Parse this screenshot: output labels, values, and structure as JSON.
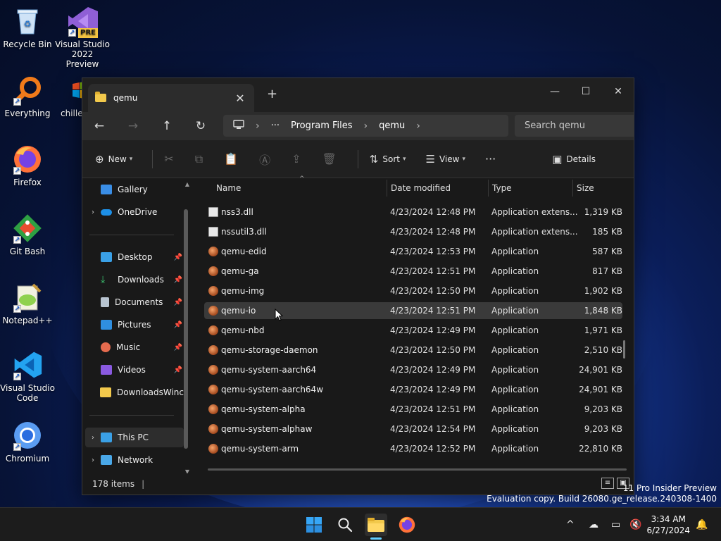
{
  "desktop": {
    "icons": [
      {
        "label": "Recycle Bin"
      },
      {
        "label": "Visual Studio 2022 Preview",
        "badge": "PRE"
      },
      {
        "label": "Everything"
      },
      {
        "label": "chille"
      },
      {
        "label": "Firefox"
      },
      {
        "label": "Git Bash"
      },
      {
        "label": "Notepad++"
      },
      {
        "label": "Visual Studio Code"
      },
      {
        "label": "Chromium"
      }
    ]
  },
  "window": {
    "tab_title": "qemu",
    "close_glyph": "✕",
    "new_tab_glyph": "+",
    "minimize_glyph": "—",
    "maximize_glyph": "☐",
    "close_window_glyph": "✕"
  },
  "nav": {
    "back": "←",
    "forward": "→",
    "up": "↑",
    "refresh": "↻",
    "breadcrumb": [
      "Program Files",
      "qemu"
    ],
    "ellipsis": "···",
    "search_placeholder": "Search qemu"
  },
  "toolbar": {
    "new_label": "New",
    "sort_label": "Sort",
    "view_label": "View",
    "more_glyph": "···",
    "details_label": "Details"
  },
  "sidebar": {
    "items": [
      {
        "label": "Gallery"
      },
      {
        "label": "OneDrive"
      },
      {
        "label": "Desktop"
      },
      {
        "label": "Downloads"
      },
      {
        "label": "Documents"
      },
      {
        "label": "Pictures"
      },
      {
        "label": "Music"
      },
      {
        "label": "Videos"
      },
      {
        "label": "DownloadsWinc"
      },
      {
        "label": "This PC"
      },
      {
        "label": "Network"
      }
    ]
  },
  "files": {
    "columns": {
      "name": "Name",
      "date": "Date modified",
      "type": "Type",
      "size": "Size"
    },
    "rows": [
      {
        "name": "nss3.dll",
        "date": "4/23/2024 12:48 PM",
        "type": "Application extens...",
        "size": "1,319 KB",
        "kind": "dll"
      },
      {
        "name": "nssutil3.dll",
        "date": "4/23/2024 12:48 PM",
        "type": "Application extens...",
        "size": "185 KB",
        "kind": "dll"
      },
      {
        "name": "qemu-edid",
        "date": "4/23/2024 12:53 PM",
        "type": "Application",
        "size": "587 KB",
        "kind": "app"
      },
      {
        "name": "qemu-ga",
        "date": "4/23/2024 12:51 PM",
        "type": "Application",
        "size": "817 KB",
        "kind": "app"
      },
      {
        "name": "qemu-img",
        "date": "4/23/2024 12:50 PM",
        "type": "Application",
        "size": "1,902 KB",
        "kind": "app"
      },
      {
        "name": "qemu-io",
        "date": "4/23/2024 12:51 PM",
        "type": "Application",
        "size": "1,848 KB",
        "kind": "app"
      },
      {
        "name": "qemu-nbd",
        "date": "4/23/2024 12:49 PM",
        "type": "Application",
        "size": "1,971 KB",
        "kind": "app"
      },
      {
        "name": "qemu-storage-daemon",
        "date": "4/23/2024 12:50 PM",
        "type": "Application",
        "size": "2,510 KB",
        "kind": "app"
      },
      {
        "name": "qemu-system-aarch64",
        "date": "4/23/2024 12:49 PM",
        "type": "Application",
        "size": "24,901 KB",
        "kind": "app"
      },
      {
        "name": "qemu-system-aarch64w",
        "date": "4/23/2024 12:49 PM",
        "type": "Application",
        "size": "24,901 KB",
        "kind": "app"
      },
      {
        "name": "qemu-system-alpha",
        "date": "4/23/2024 12:51 PM",
        "type": "Application",
        "size": "9,203 KB",
        "kind": "app"
      },
      {
        "name": "qemu-system-alphaw",
        "date": "4/23/2024 12:54 PM",
        "type": "Application",
        "size": "9,203 KB",
        "kind": "app"
      },
      {
        "name": "qemu-system-arm",
        "date": "4/23/2024 12:52 PM",
        "type": "Application",
        "size": "22,810 KB",
        "kind": "app"
      }
    ]
  },
  "status": {
    "item_count": "178 items"
  },
  "watermark": {
    "line1": "11 Pro Insider Preview",
    "line2": "Evaluation copy. Build 26080.ge_release.240308-1400"
  },
  "taskbar": {
    "time": "3:34 AM",
    "date": "6/27/2024",
    "tray_chevron": "^"
  },
  "colors": {
    "accent": "#60cdff",
    "folder": "#f2c94c"
  }
}
